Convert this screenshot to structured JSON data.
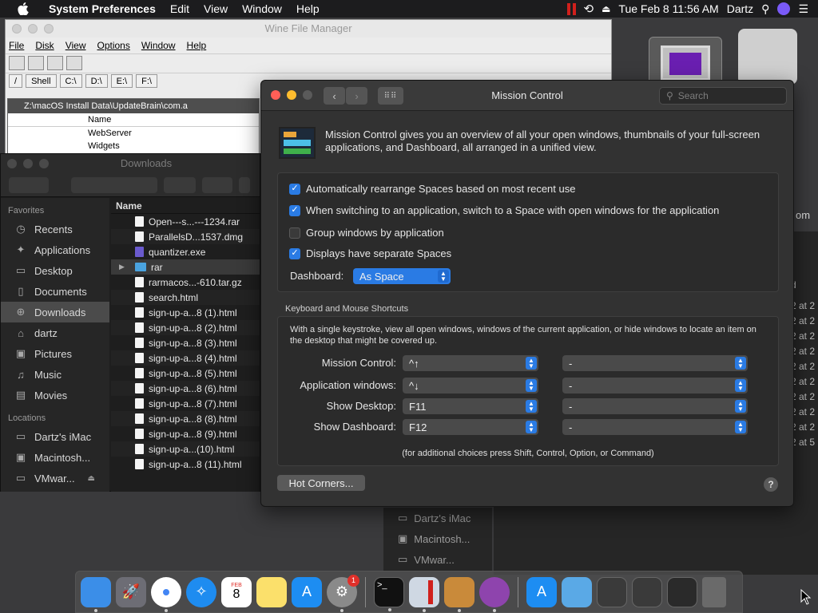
{
  "menubar": {
    "app": "System Preferences",
    "items": [
      "Edit",
      "View",
      "Window",
      "Help"
    ],
    "datetime": "Tue Feb 8  11:56 AM",
    "user": "Dartz"
  },
  "wine": {
    "title": "Wine File Manager",
    "menu": [
      "File",
      "Disk",
      "View",
      "Options",
      "Window",
      "Help"
    ],
    "drives": [
      "/",
      "Shell",
      "C:\\",
      "D:\\",
      "E:\\",
      "F:\\"
    ],
    "subtitle": "Z:\\macOS Install Data\\UpdateBrain\\com.a",
    "col": "Name",
    "rows": [
      "WebServer",
      "Widgets"
    ]
  },
  "finder": {
    "title": "Downloads",
    "favorites_header": "Favorites",
    "favorites": [
      {
        "label": "Recents",
        "icon": "clock-icon"
      },
      {
        "label": "Applications",
        "icon": "applications-icon"
      },
      {
        "label": "Desktop",
        "icon": "desktop-icon"
      },
      {
        "label": "Documents",
        "icon": "document-icon"
      },
      {
        "label": "Downloads",
        "icon": "download-icon"
      },
      {
        "label": "dartz",
        "icon": "home-icon"
      },
      {
        "label": "Pictures",
        "icon": "pictures-icon"
      },
      {
        "label": "Music",
        "icon": "music-icon"
      },
      {
        "label": "Movies",
        "icon": "movies-icon"
      }
    ],
    "locations_header": "Locations",
    "locations": [
      "Dartz's iMac",
      "Macintosh...",
      "VMwar..."
    ],
    "name_header": "Name",
    "files": [
      "Open---s...---1234.rar",
      "ParallelsD...1537.dmg",
      "quantizer.exe",
      "rar",
      "rarmacos...-610.tar.gz",
      "search.html",
      "sign-up-a...8 (1).html",
      "sign-up-a...8 (2).html",
      "sign-up-a...8 (3).html",
      "sign-up-a...8 (4).html",
      "sign-up-a...8 (5).html",
      "sign-up-a...8 (6).html",
      "sign-up-a...8 (7).html",
      "sign-up-a...8 (8).html",
      "sign-up-a...8 (9).html",
      "sign-up-a...(10).html",
      "sign-up-a...8 (11).html"
    ]
  },
  "mc": {
    "title": "Mission Control",
    "search_placeholder": "Search",
    "intro": "Mission Control gives you an overview of all your open windows, thumbnails of your full-screen applications, and Dashboard, all arranged in a unified view.",
    "options": [
      {
        "label": "Automatically rearrange Spaces based on most recent use",
        "checked": true
      },
      {
        "label": "When switching to an application, switch to a Space with open windows for the application",
        "checked": true
      },
      {
        "label": "Group windows by application",
        "checked": false
      },
      {
        "label": "Displays have separate Spaces",
        "checked": true
      }
    ],
    "dashboard_label": "Dashboard:",
    "dashboard_value": "As Space",
    "shortcuts_title": "Keyboard and Mouse Shortcuts",
    "shortcuts_desc": "With a single keystroke, view all open windows, windows of the current application, or hide windows to locate an item on the desktop that might be covered up.",
    "shortcuts": [
      {
        "label": "Mission Control:",
        "key": "^↑",
        "mouse": "-"
      },
      {
        "label": "Application windows:",
        "key": "^↓",
        "mouse": "-"
      },
      {
        "label": "Show Desktop:",
        "key": "F11",
        "mouse": "-"
      },
      {
        "label": "Show Dashboard:",
        "key": "F12",
        "mouse": "-"
      }
    ],
    "note": "(for additional choices press Shift, Control, Option, or Command)",
    "hot_corners": "Hot Corners...",
    "help": "?"
  },
  "background": {
    "col_header": "d",
    "dates": [
      "2 at 2",
      "2 at 2",
      "2 at 2",
      "2 at 2",
      "2 at 2",
      "2 at 2",
      "2 at 2",
      "2 at 2",
      "2 at 2",
      "2 at 5"
    ],
    "locations": [
      "Dartz's iMac",
      "Macintosh...",
      "VMwar..."
    ],
    "right_text": "om"
  },
  "dock": {
    "calendar_month": "FEB",
    "calendar_day": "8",
    "badge": "1"
  },
  "colors": {
    "accent": "#2a7be4",
    "menubar": "#1c1c1e"
  }
}
